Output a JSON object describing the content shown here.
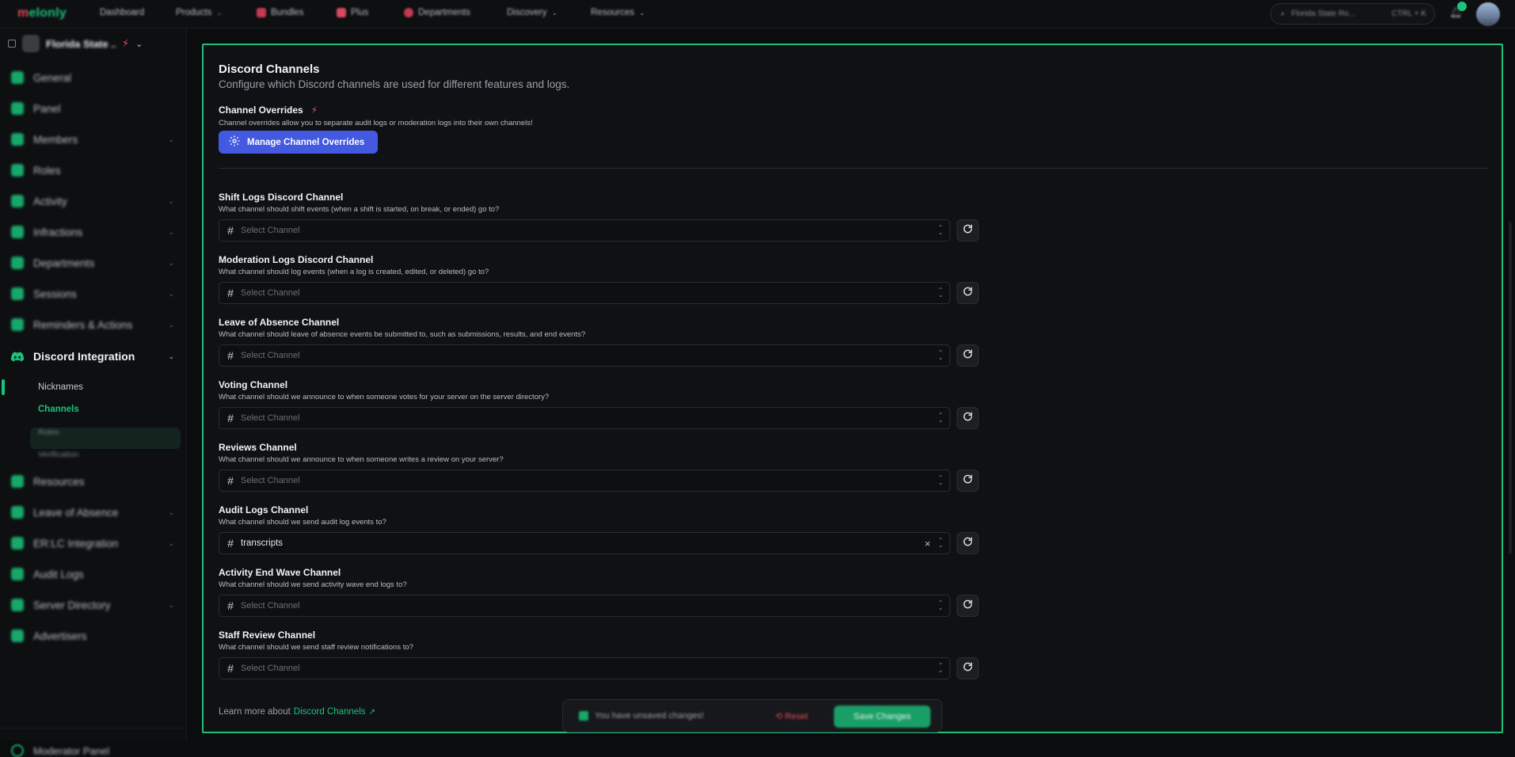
{
  "topbar": {
    "logo_prefix": "m",
    "logo_rest": "elonly",
    "nav": [
      {
        "label": "Dashboard",
        "icon": "dashboard-icon",
        "blurred": true
      },
      {
        "label": "Products",
        "icon": "products-icon",
        "blurred": true
      },
      {
        "label": "Bundles",
        "icon": "bundles-icon"
      },
      {
        "label": "Plus",
        "icon": "plus-icon"
      },
      {
        "label": "Departments",
        "icon": "departments-icon"
      },
      {
        "label": "Discovery",
        "icon": "discovery-icon"
      },
      {
        "label": "Resources",
        "icon": "resources-icon"
      }
    ],
    "search_text": "Florida State Ro...",
    "search_shortcut": "CTRL + K"
  },
  "sidebar": {
    "server_name": "Florida State ...",
    "items": [
      {
        "label": "General",
        "icon": "globe-icon"
      },
      {
        "label": "Panel",
        "icon": "monitor-icon"
      },
      {
        "label": "Members",
        "icon": "members-icon"
      },
      {
        "label": "Roles",
        "icon": "key-icon"
      },
      {
        "label": "Activity",
        "icon": "activity-icon"
      },
      {
        "label": "Infractions",
        "icon": "infractions-icon"
      },
      {
        "label": "Departments",
        "icon": "departments-icon"
      },
      {
        "label": "Sessions",
        "icon": "sessions-icon"
      },
      {
        "label": "Reminders & Actions",
        "icon": "reminders-icon"
      },
      {
        "label": "Discord Integration",
        "icon": "discord-icon"
      },
      {
        "label": "Resources",
        "icon": "resources-icon"
      },
      {
        "label": "Leave of Absence",
        "icon": "calendar-icon"
      },
      {
        "label": "ER:LC Integration",
        "icon": "link-icon"
      },
      {
        "label": "Audit Logs",
        "icon": "audit-icon"
      },
      {
        "label": "Server Directory",
        "icon": "directory-icon"
      },
      {
        "label": "Advertisers",
        "icon": "megaphone-icon"
      }
    ],
    "subitems": [
      "Nicknames",
      "Channels",
      "Roles",
      "Verification"
    ],
    "bottom_label": "Moderator Panel"
  },
  "main": {
    "title": "Discord Channels",
    "subtitle": "Configure which Discord channels are used for different features and logs.",
    "overrides_title": "Channel Overrides",
    "overrides_desc": "Channel overrides allow you to separate audit logs or moderation logs into their own channels!",
    "manage_button": "Manage Channel Overrides",
    "placeholder": "Select Channel",
    "fields": [
      {
        "label": "Shift Logs Discord Channel",
        "desc": "What channel should shift events (when a shift is started, on break, or ended) go to?",
        "value": ""
      },
      {
        "label": "Moderation Logs Discord Channel",
        "desc": "What channel should log events (when a log is created, edited, or deleted) go to?",
        "value": ""
      },
      {
        "label": "Leave of Absence Channel",
        "desc": "What channel should leave of absence events be submitted to, such as submissions, results, and end events?",
        "value": ""
      },
      {
        "label": "Voting Channel",
        "desc": "What channel should we announce to when someone votes for your server on the server directory?",
        "value": ""
      },
      {
        "label": "Reviews Channel",
        "desc": "What channel should we announce to when someone writes a review on your server?",
        "value": ""
      },
      {
        "label": "Audit Logs Channel",
        "desc": "What channel should we send audit log events to?",
        "value": "transcripts"
      },
      {
        "label": "Activity End Wave Channel",
        "desc": "What channel should we send activity wave end logs to?",
        "value": ""
      },
      {
        "label": "Staff Review Channel",
        "desc": "What channel should we send staff review notifications to?",
        "value": ""
      }
    ],
    "learn_prefix": "Learn more about",
    "learn_link": "Discord Channels"
  },
  "unsaved": {
    "text": "You have unsaved changes!",
    "reset": "Reset",
    "save": "Save Changes"
  },
  "colors": {
    "accent": "#19c37d",
    "primary_button": "#4359e0",
    "plus_badge": "#e54b5c",
    "background": "#0b0c0e"
  }
}
